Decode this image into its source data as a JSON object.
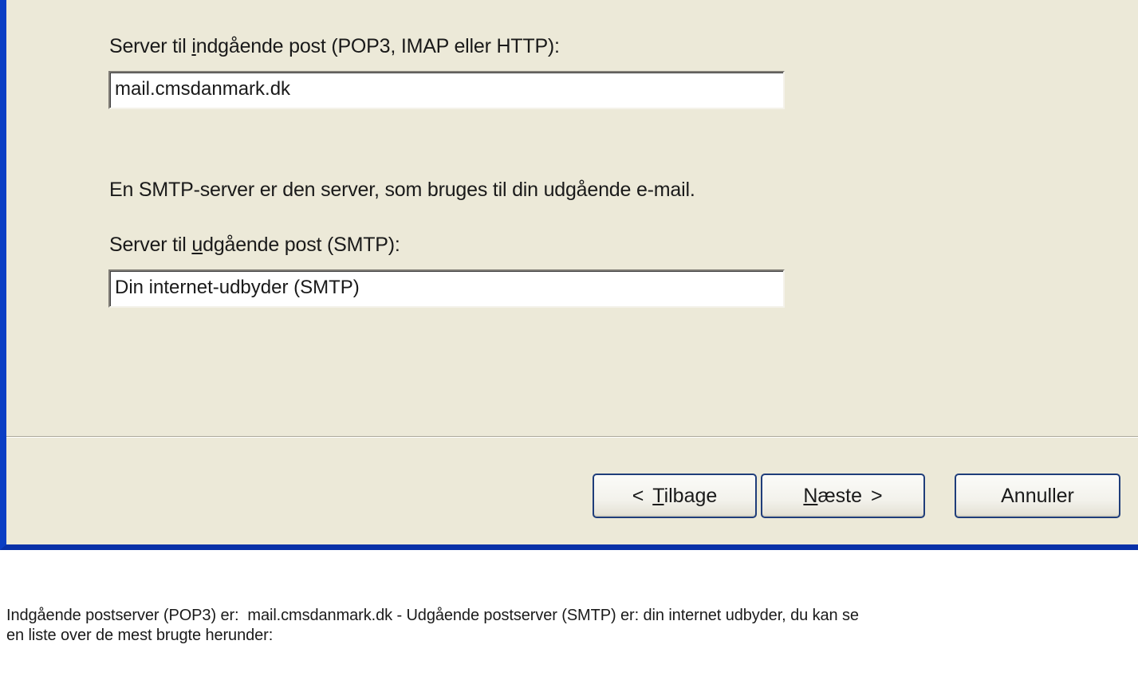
{
  "dialog": {
    "incoming_label_pre": "Server til ",
    "incoming_label_mnemonic": "i",
    "incoming_label_post": "ndgående post (POP3, IMAP eller HTTP):",
    "incoming_value": "mail.cmsdanmark.dk",
    "smtp_info": "En SMTP-server er den server, som bruges til din udgående e-mail.",
    "outgoing_label_pre": "Server til ",
    "outgoing_label_mnemonic": "u",
    "outgoing_label_post": "dgående post (SMTP):",
    "outgoing_value": "Din internet-udbyder (SMTP)"
  },
  "buttons": {
    "back_prefix": "< ",
    "back_mnemonic": "T",
    "back_rest": "ilbage",
    "next_mnemonic": "N",
    "next_rest": "æste",
    "next_suffix": " >",
    "cancel": "Annuller"
  },
  "page_text": {
    "info_line1": "Indgående postserver (POP3) er:  mail.cmsdanmark.dk - Udgående postserver (SMTP) er: din internet udbyder, du kan se",
    "info_line2": "en liste over de mest brugte herunder:"
  },
  "colors": {
    "dialog_bg": "#ece9d8",
    "window_border": "#0a3ec4",
    "button_border": "#1f3d7a"
  }
}
